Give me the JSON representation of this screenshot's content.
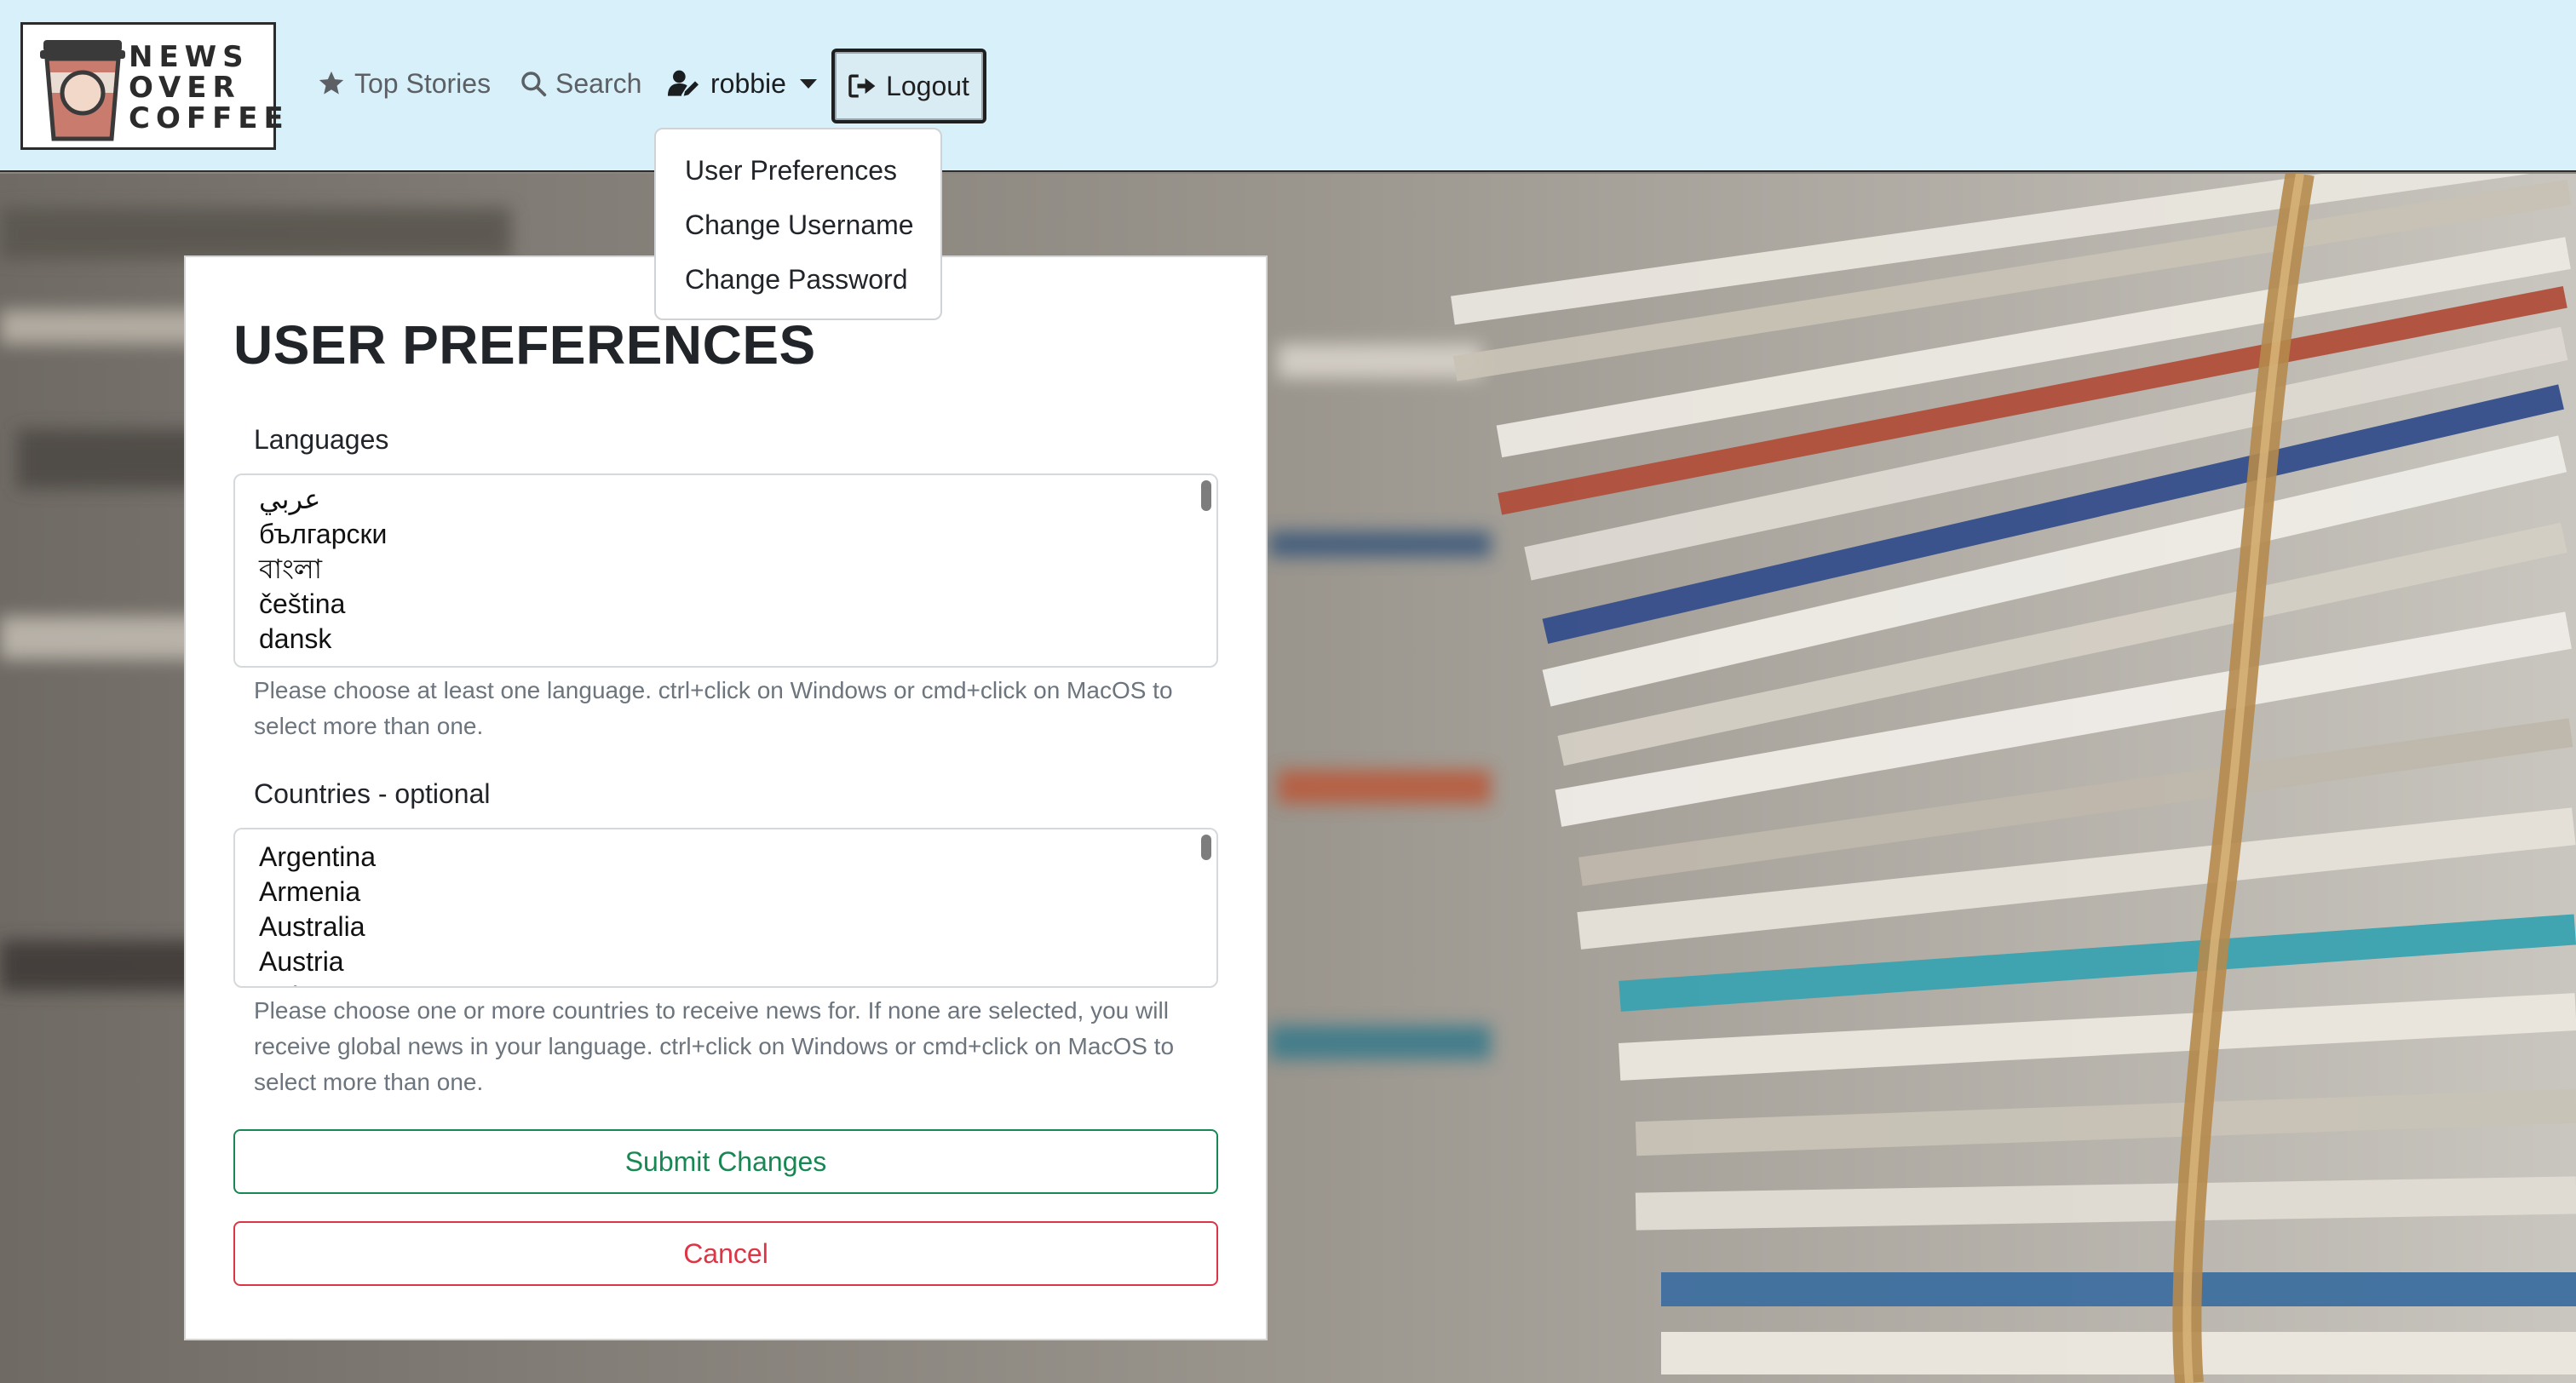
{
  "brand": {
    "line1": "NEWS",
    "line2": "OVER",
    "line3": "COFFEE"
  },
  "nav": {
    "top_stories": "Top Stories",
    "search": "Search",
    "user": "robbie",
    "logout": "Logout"
  },
  "dropdown": {
    "items": [
      {
        "label": "User Preferences"
      },
      {
        "label": "Change Username"
      },
      {
        "label": "Change Password"
      }
    ]
  },
  "form": {
    "title": "USER PREFERENCES",
    "languages_label": "Languages",
    "languages": [
      "عربي",
      "български",
      "বাংলা",
      "čeština",
      "dansk"
    ],
    "languages_help": "Please choose at least one language. ctrl+click on Windows or cmd+click on MacOS to select more than one.",
    "countries_label": "Countries - optional",
    "countries": [
      "Argentina",
      "Armenia",
      "Australia",
      "Austria",
      "Belarus"
    ],
    "countries_help": "Please choose one or more countries to receive news for. If none are selected, you will receive global news in your language. ctrl+click on Windows or cmd+click on MacOS to select more than one.",
    "submit": "Submit Changes",
    "cancel": "Cancel"
  },
  "colors": {
    "navbar_bg": "#d7f0f9",
    "success": "#198754",
    "danger": "#dc3545",
    "muted_text": "#6c757d"
  }
}
